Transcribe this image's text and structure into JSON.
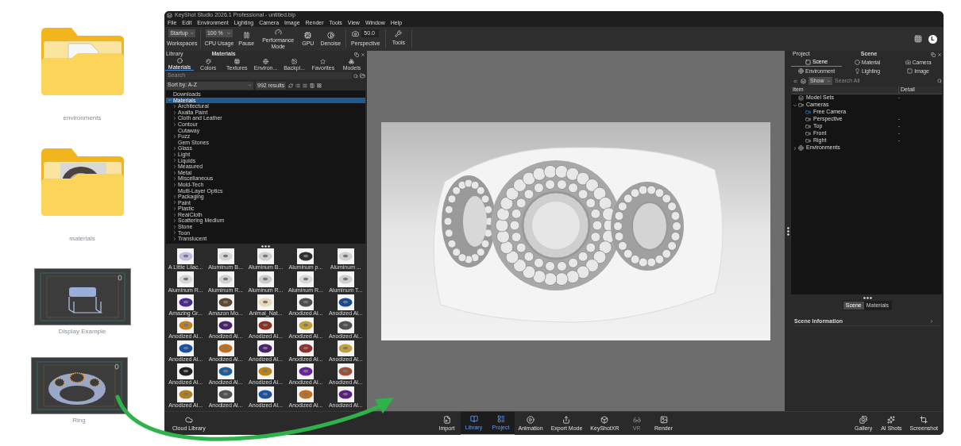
{
  "desktop": {
    "items": [
      {
        "kind": "folder",
        "label": "environments"
      },
      {
        "kind": "folder-image",
        "label": "materials"
      },
      {
        "kind": "scene-sofa",
        "label": "Display Example"
      },
      {
        "kind": "scene-ring",
        "label": "Ring"
      }
    ]
  },
  "window": {
    "title": "KeyShot Studio 2026.1 Professional - untitled.bip",
    "user_initial": "L"
  },
  "menu": [
    "File",
    "Edit",
    "Environment",
    "Lighting",
    "Camera",
    "Image",
    "Render",
    "Tools",
    "View",
    "Window",
    "Help"
  ],
  "toolbar": {
    "workspace": {
      "value": "Startup",
      "label": "Workspaces"
    },
    "cpu": {
      "value": "100 %",
      "label": "CPU Usage"
    },
    "buttons": [
      {
        "kind": "pause",
        "label": "Pause"
      },
      {
        "kind": "performance",
        "label": "Performance Mode"
      },
      {
        "kind": "gpu",
        "label": "GPU"
      },
      {
        "kind": "denoise",
        "label": "Denoise"
      }
    ],
    "camera": {
      "value": "50.0",
      "label": "Perspective"
    },
    "tools": {
      "label": "Tools"
    }
  },
  "library": {
    "header": "Library",
    "title": "Materials",
    "tabs": [
      {
        "kind": "materials",
        "label": "Materials",
        "selected": true
      },
      {
        "kind": "colors",
        "label": "Colors",
        "selected": false
      },
      {
        "kind": "textures",
        "label": "Textures",
        "selected": false
      },
      {
        "kind": "environments",
        "label": "Environ...",
        "selected": false
      },
      {
        "kind": "backplates",
        "label": "Backpl...",
        "selected": false
      },
      {
        "kind": "favorites",
        "label": "Favorites",
        "selected": false
      },
      {
        "kind": "models",
        "label": "Models",
        "selected": false
      }
    ],
    "search": {
      "placeholder": "Search"
    },
    "sort": "Sort by: A-Z",
    "results": "992 results",
    "tree": [
      {
        "label": "Downloads",
        "selected": false
      },
      {
        "label": "Materials",
        "selected": true,
        "expanded": true,
        "children": [
          {
            "label": "Architectural",
            "expanded": false,
            "selected": false
          },
          {
            "label": "Axalta Paint",
            "expanded": false,
            "selected": false
          },
          {
            "label": "Cloth and Leather",
            "expanded": false,
            "selected": false
          },
          {
            "label": "Contour",
            "expanded": false,
            "selected": false
          },
          {
            "label": "Cutaway",
            "selected": false
          },
          {
            "label": "Fuzz",
            "expanded": false,
            "selected": false
          },
          {
            "label": "Gem Stones",
            "selected": false
          },
          {
            "label": "Glass",
            "expanded": false,
            "selected": false
          },
          {
            "label": "Light",
            "expanded": false,
            "selected": false
          },
          {
            "label": "Liquids",
            "expanded": false,
            "selected": false
          },
          {
            "label": "Measured",
            "expanded": false,
            "selected": false
          },
          {
            "label": "Metal",
            "expanded": false,
            "selected": false
          },
          {
            "label": "Miscellaneous",
            "expanded": false,
            "selected": false
          },
          {
            "label": "Mold-Tech",
            "expanded": false,
            "selected": false
          },
          {
            "label": "Multi-Layer Optics",
            "selected": false
          },
          {
            "label": "Packaging",
            "expanded": false,
            "selected": false
          },
          {
            "label": "Paint",
            "expanded": false,
            "selected": false
          },
          {
            "label": "Plastic",
            "expanded": false,
            "selected": false
          },
          {
            "label": "RealCloth",
            "expanded": false,
            "selected": false
          },
          {
            "label": "Scattering Medium",
            "expanded": false,
            "selected": false
          },
          {
            "label": "Stone",
            "expanded": false,
            "selected": false
          },
          {
            "label": "Toon",
            "expanded": false,
            "selected": false
          },
          {
            "label": "Translucent",
            "expanded": false,
            "selected": false
          }
        ]
      }
    ],
    "thumbnails": [
      {
        "label": "A Little Lilac...",
        "color": "#c4bce0"
      },
      {
        "label": "Aluminum B...",
        "color": "#d4d4d4"
      },
      {
        "label": "Aluminum B...",
        "color": "#cfcfcf"
      },
      {
        "label": "Aluminum p...",
        "color": "#2e2e2e"
      },
      {
        "label": "Aluminum ...",
        "color": "#d0d0d0"
      },
      {
        "label": "Aluminum R...",
        "color": "#d6d6d6"
      },
      {
        "label": "Aluminum R...",
        "color": "#d2d2d2"
      },
      {
        "label": "Aluminum R...",
        "color": "#cccccc"
      },
      {
        "label": "Aluminum R...",
        "color": "#d8d8d8"
      },
      {
        "label": "Aluminum T...",
        "color": "#d0d0d0"
      },
      {
        "label": "Amazing Gr...",
        "color": "#4b2a92"
      },
      {
        "label": "Amazon Mo...",
        "color": "#5c4a30"
      },
      {
        "label": "Animal_Nat...",
        "color": "#e6d9bc"
      },
      {
        "label": "Anodized Al...",
        "color": "#4e4e4e"
      },
      {
        "label": "Anodized Al...",
        "color": "#1a4a92"
      },
      {
        "label": "Anodized Al...",
        "color": "#c08020"
      },
      {
        "label": "Anodized Al...",
        "color": "#4a2070"
      },
      {
        "label": "Anodized Al...",
        "color": "#903020"
      },
      {
        "label": "Anodized Al...",
        "color": "#c0a030"
      },
      {
        "label": "Anodized Al...",
        "color": "#505050"
      },
      {
        "label": "Anodized Al...",
        "color": "#1a50a0"
      },
      {
        "label": "Anodized Al...",
        "color": "#c07020"
      },
      {
        "label": "Anodized Al...",
        "color": "#4b2172"
      },
      {
        "label": "Anodized Al...",
        "color": "#903030"
      },
      {
        "label": "Anodized Al...",
        "color": "#c0a040"
      },
      {
        "label": "Anodized Al...",
        "color": "#202020"
      },
      {
        "label": "Anodized Al...",
        "color": "#1a60a0"
      },
      {
        "label": "Anodized Al...",
        "color": "#c08010"
      },
      {
        "label": "Anodized Al...",
        "color": "#6a20a0"
      },
      {
        "label": "Anodized Al...",
        "color": "#a05030"
      },
      {
        "label": "Anodized Al...",
        "color": "#b08020"
      },
      {
        "label": "Anodized Al...",
        "color": "#525252"
      },
      {
        "label": "Anodized Al...",
        "color": "#1b51a1"
      },
      {
        "label": "Anodized Al...",
        "color": "#c17121"
      },
      {
        "label": "Anodized Al...",
        "color": "#5a2080"
      }
    ]
  },
  "project": {
    "header": "Project",
    "title": "Scene",
    "tabs": [
      {
        "kind": "scene",
        "label": "Scene",
        "selected": true
      },
      {
        "kind": "material",
        "label": "Material",
        "selected": false
      },
      {
        "kind": "camera",
        "label": "Camera",
        "selected": false
      },
      {
        "kind": "environment",
        "label": "Environment",
        "selected": false
      },
      {
        "kind": "lighting",
        "label": "Lighting",
        "selected": false
      },
      {
        "kind": "image",
        "label": "Image",
        "selected": false
      }
    ],
    "filter": "Show",
    "search": {
      "placeholder": "Search All"
    },
    "columns": [
      "Item",
      "Detail"
    ],
    "tree": [
      {
        "kind": "models",
        "label": "Model Sets",
        "detail": "-"
      },
      {
        "kind": "cameras",
        "label": "Cameras",
        "expanded": true,
        "children": [
          {
            "kind": "camera",
            "label": "Free Camera",
            "active": true
          },
          {
            "kind": "camera",
            "label": "Perspective",
            "detail": "-",
            "active": false
          },
          {
            "kind": "camera",
            "label": "Top",
            "detail": "-",
            "active": false
          },
          {
            "kind": "camera",
            "label": "Front",
            "detail": "-",
            "active": false
          },
          {
            "kind": "camera",
            "label": "Right",
            "detail": "-",
            "active": false
          }
        ]
      },
      {
        "kind": "environments",
        "label": "Environments",
        "expanded": false
      }
    ],
    "toggle": [
      {
        "label": "Scene",
        "selected": true
      },
      {
        "label": "Materials",
        "selected": false
      }
    ],
    "section": "Scene Information"
  },
  "bottom_bar": {
    "left": [
      {
        "kind": "cloud",
        "label": "Cloud Library",
        "selected": false,
        "disabled": false
      }
    ],
    "center": [
      {
        "kind": "import",
        "label": "Import",
        "selected": false,
        "disabled": false
      },
      {
        "kind": "library",
        "label": "Library",
        "selected": true,
        "disabled": false
      },
      {
        "kind": "project",
        "label": "Project",
        "selected": true,
        "disabled": false
      },
      {
        "kind": "animation",
        "label": "Animation",
        "selected": false,
        "disabled": false
      },
      {
        "kind": "export",
        "label": "Export Mode",
        "selected": false,
        "disabled": false
      },
      {
        "kind": "xr",
        "label": "KeyShotXR",
        "selected": false,
        "disabled": false
      },
      {
        "kind": "vr",
        "label": "VR",
        "selected": false,
        "disabled": true
      },
      {
        "kind": "render",
        "label": "Render",
        "selected": false,
        "disabled": false
      }
    ],
    "right": [
      {
        "kind": "gallery",
        "label": "Gallery",
        "selected": false,
        "disabled": false
      },
      {
        "kind": "ai",
        "label": "AI Shots",
        "selected": false,
        "disabled": false
      },
      {
        "kind": "screenshot",
        "label": "Screenshot",
        "selected": false,
        "disabled": false
      }
    ]
  }
}
